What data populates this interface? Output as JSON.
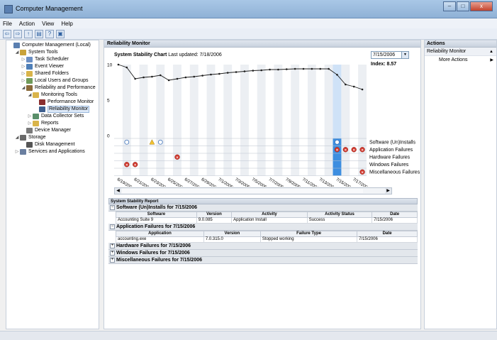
{
  "window": {
    "title": "Computer Management",
    "min_label": "–",
    "max_label": "□",
    "close_label": "x"
  },
  "menu": [
    "File",
    "Action",
    "View",
    "Help"
  ],
  "toolbar_glyphs": [
    "⇦",
    "⇨",
    "↑",
    "▤",
    "?",
    "▣"
  ],
  "tree": [
    {
      "label": "Computer Management (Local)",
      "indent": 0,
      "twisty": "",
      "icon": "#5a7fb0",
      "name": "computer-icon"
    },
    {
      "label": "System Tools",
      "indent": 1,
      "twisty": "◢",
      "icon": "#c9a23a",
      "name": "tools-icon"
    },
    {
      "label": "Task Scheduler",
      "indent": 2,
      "twisty": "▷",
      "icon": "#6b8fc4",
      "name": "clock-icon"
    },
    {
      "label": "Event Viewer",
      "indent": 2,
      "twisty": "▷",
      "icon": "#4f7fb8",
      "name": "event-icon"
    },
    {
      "label": "Shared Folders",
      "indent": 2,
      "twisty": "▷",
      "icon": "#d9b44a",
      "name": "folder-icon"
    },
    {
      "label": "Local Users and Groups",
      "indent": 2,
      "twisty": "▷",
      "icon": "#6f9a5a",
      "name": "users-icon"
    },
    {
      "label": "Reliability and Performance",
      "indent": 2,
      "twisty": "◢",
      "icon": "#8a6a3a",
      "name": "gauge-icon"
    },
    {
      "label": "Monitoring Tools",
      "indent": 3,
      "twisty": "◢",
      "icon": "#d9b44a",
      "name": "folder-icon"
    },
    {
      "label": "Performance Monitor",
      "indent": 4,
      "twisty": "",
      "icon": "#8a2f2f",
      "name": "performance-icon"
    },
    {
      "label": "Reliability Monitor",
      "indent": 4,
      "twisty": "",
      "icon": "#3e5f8f",
      "name": "reliability-icon",
      "selected": true
    },
    {
      "label": "Data Collector Sets",
      "indent": 3,
      "twisty": "▷",
      "icon": "#5a8f6a",
      "name": "collector-icon"
    },
    {
      "label": "Reports",
      "indent": 3,
      "twisty": "▷",
      "icon": "#d9b44a",
      "name": "reports-icon"
    },
    {
      "label": "Device Manager",
      "indent": 2,
      "twisty": "",
      "icon": "#7a7a7a",
      "name": "device-icon"
    },
    {
      "label": "Storage",
      "indent": 1,
      "twisty": "◢",
      "icon": "#6a6a6a",
      "name": "storage-icon"
    },
    {
      "label": "Disk Management",
      "indent": 2,
      "twisty": "",
      "icon": "#555555",
      "name": "disk-icon"
    },
    {
      "label": "Services and Applications",
      "indent": 1,
      "twisty": "▷",
      "icon": "#6a7fa0",
      "name": "services-icon"
    }
  ],
  "center": {
    "header": "Reliability Monitor",
    "chart_title": "System Stability Chart",
    "last_updated": "Last updated: 7/18/2006",
    "selected_date": "7/15/2006",
    "dropdown_glyph": "▼",
    "index_label": "Index: 8.57",
    "scroll_left": "◀",
    "scroll_right": "▶"
  },
  "chart_data": {
    "type": "line",
    "title": "System Stability Chart",
    "ylim": [
      0,
      10
    ],
    "yticks": [
      0,
      5,
      10
    ],
    "x_tick_labels": [
      "6/19/2006",
      "6/21/2006",
      "6/23/2006",
      "6/25/2006",
      "6/27/2006",
      "6/29/2006",
      "7/1/2006",
      "7/3/2006",
      "7/5/2006",
      "7/7/2006",
      "7/9/2006",
      "7/11/2006",
      "7/13/2006",
      "7/15/2006",
      "7/17/2006"
    ],
    "selected_index": 26,
    "series": [
      {
        "values": [
          10,
          9.6,
          8.0,
          8.2,
          8.3,
          8.5,
          7.8,
          8.0,
          8.2,
          8.3,
          8.45,
          8.6,
          8.7,
          8.85,
          8.95,
          9.05,
          9.15,
          9.2,
          9.3,
          9.3,
          9.35,
          9.4,
          9.4,
          9.4,
          9.4,
          9.4,
          8.57,
          7.2,
          6.9,
          6.5
        ]
      }
    ],
    "row_labels": [
      "Software (Un)Installs",
      "Application Failures",
      "Hardware Failures",
      "Windows Failures",
      "Miscellaneous Failures"
    ],
    "events": [
      {
        "row": 0,
        "day": 1,
        "kind": "info"
      },
      {
        "row": 0,
        "day": 4,
        "kind": "warning"
      },
      {
        "row": 0,
        "day": 5,
        "kind": "info"
      },
      {
        "row": 0,
        "day": 26,
        "kind": "info"
      },
      {
        "row": 1,
        "day": 26,
        "kind": "error"
      },
      {
        "row": 1,
        "day": 27,
        "kind": "error"
      },
      {
        "row": 1,
        "day": 28,
        "kind": "error"
      },
      {
        "row": 1,
        "day": 29,
        "kind": "error"
      },
      {
        "row": 2,
        "day": 7,
        "kind": "error"
      },
      {
        "row": 3,
        "day": 1,
        "kind": "error"
      },
      {
        "row": 3,
        "day": 2,
        "kind": "error"
      },
      {
        "row": 4,
        "day": 29,
        "kind": "error"
      }
    ]
  },
  "report": {
    "header": "System Stability Report",
    "sections": [
      {
        "title": "Software (Un)Installs for 7/15/2006",
        "expanded": true,
        "columns": [
          "Software",
          "Version",
          "Activity",
          "Activity Status",
          "Date"
        ],
        "rows": [
          [
            "Accounting Suite 9",
            "9.0.085",
            "Application Install",
            "Success",
            "7/15/2006"
          ]
        ]
      },
      {
        "title": "Application Failures for 7/15/2006",
        "expanded": true,
        "columns": [
          "Application",
          "Version",
          "Failure Type",
          "Date"
        ],
        "rows": [
          [
            "accounting.exe",
            "7.0.315.0",
            "Stopped working",
            "7/15/2006"
          ]
        ]
      },
      {
        "title": "Hardware Failures for 7/15/2006",
        "expanded": false
      },
      {
        "title": "Windows Failures for 7/15/2006",
        "expanded": false
      },
      {
        "title": "Miscellaneous Failures for 7/15/2006",
        "expanded": false
      }
    ],
    "minus": "−",
    "plus": "+"
  },
  "actions": {
    "header": "Actions",
    "subheader": "Reliability Monitor",
    "subheader_glyph": "▲",
    "item": "More Actions",
    "item_glyph": "▶"
  }
}
